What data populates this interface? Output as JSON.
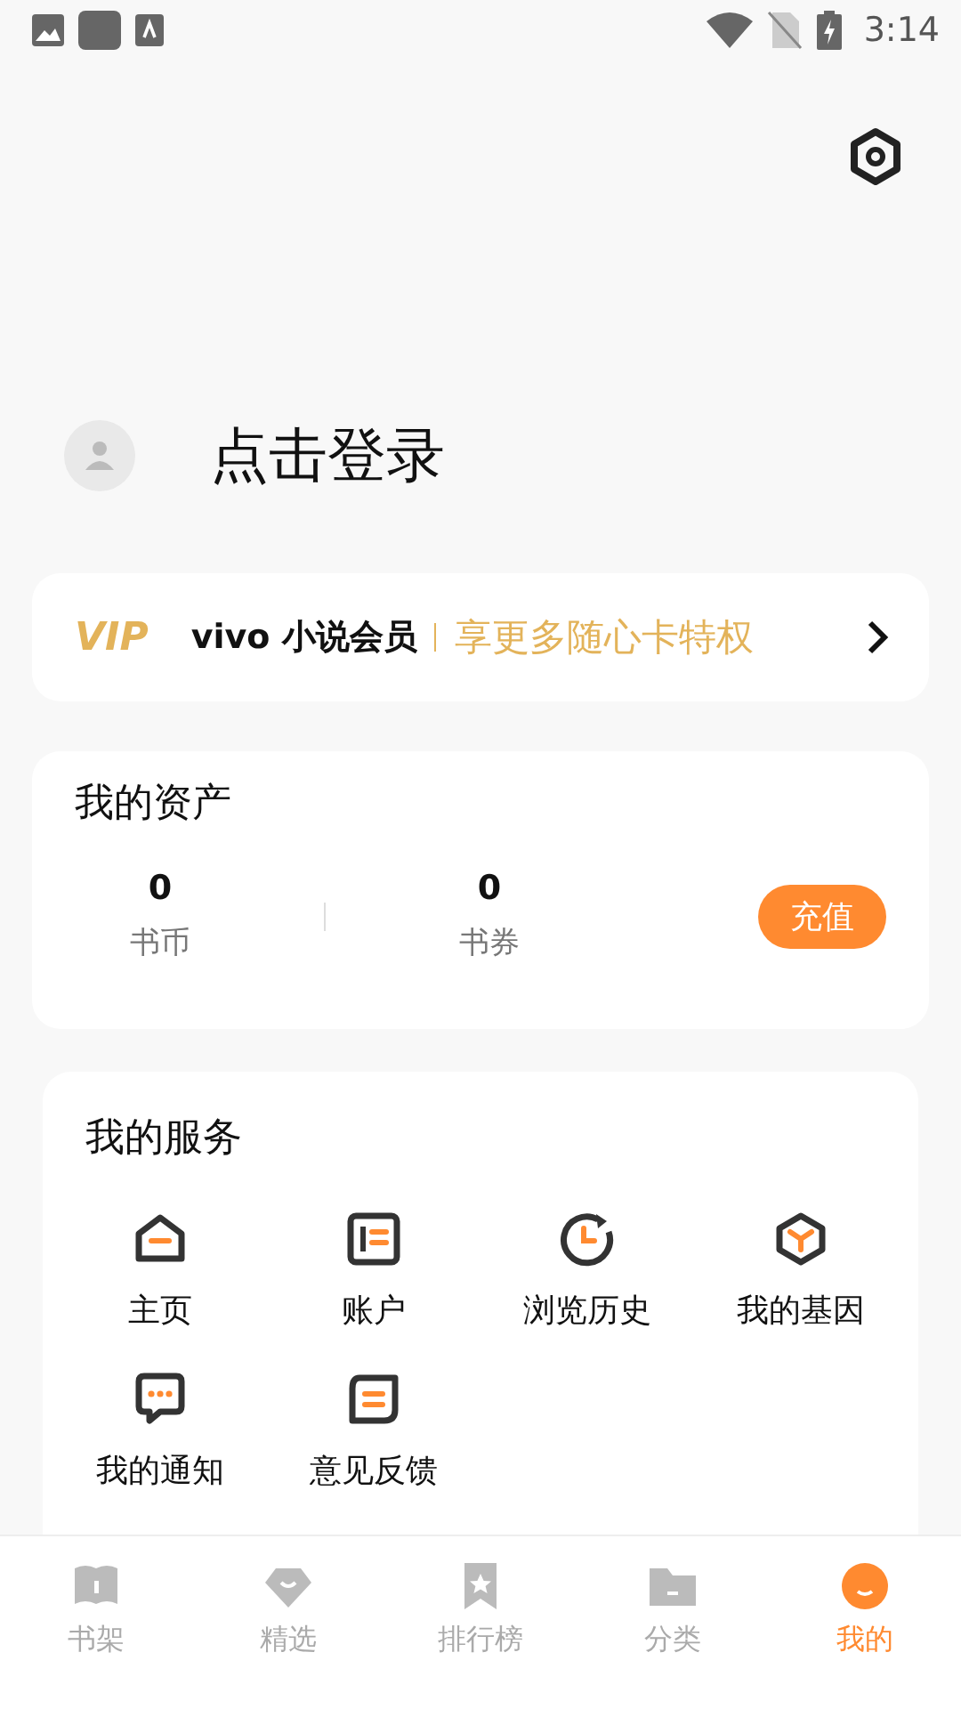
{
  "status_bar": {
    "time": "3:14"
  },
  "profile": {
    "login_label": "点击登录"
  },
  "vip_banner": {
    "badge": "VIP",
    "brand": "vivo 小说会员",
    "slogan": "享更多随心卡特权"
  },
  "assets": {
    "title": "我的资产",
    "items": [
      {
        "value": "0",
        "label": "书币"
      },
      {
        "value": "0",
        "label": "书券"
      }
    ],
    "button": "充值"
  },
  "services": {
    "title": "我的服务",
    "items": [
      {
        "kind": "home",
        "label": "主页"
      },
      {
        "kind": "account",
        "label": "账户"
      },
      {
        "kind": "history",
        "label": "浏览历史"
      },
      {
        "kind": "gene",
        "label": "我的基因"
      },
      {
        "kind": "notice",
        "label": "我的通知"
      },
      {
        "kind": "feedback",
        "label": "意见反馈"
      }
    ]
  },
  "tabs": [
    {
      "kind": "shelf",
      "label": "书架",
      "selected": false
    },
    {
      "kind": "featured",
      "label": "精选",
      "selected": false
    },
    {
      "kind": "rank",
      "label": "排行榜",
      "selected": false
    },
    {
      "kind": "category",
      "label": "分类",
      "selected": false
    },
    {
      "kind": "me",
      "label": "我的",
      "selected": true
    }
  ]
}
